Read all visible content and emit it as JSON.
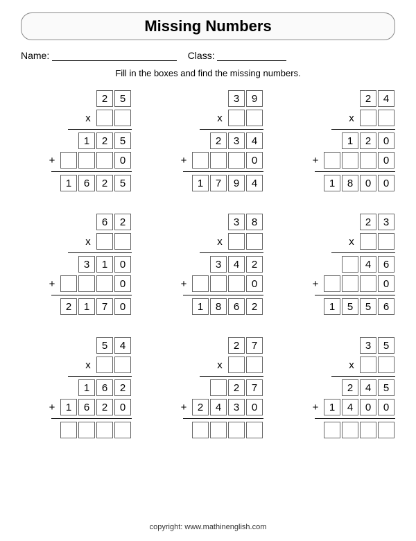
{
  "title": "Missing Numbers",
  "name_label": "Name:",
  "class_label": "Class:",
  "instruction": "Fill in the boxes and find the missing numbers.",
  "copyright": "copyright:   www.mathinenglish.com",
  "problems": [
    {
      "top": [
        "2",
        "5"
      ],
      "mult": [
        "",
        ""
      ],
      "p1": [
        "1",
        "2",
        "5"
      ],
      "p2": [
        "",
        "",
        "",
        "0"
      ],
      "p2box": [
        1,
        1,
        1,
        0
      ],
      "ans": [
        "1",
        "6",
        "2",
        "5"
      ],
      "ansbox": [
        0,
        0,
        0,
        0
      ]
    },
    {
      "top": [
        "3",
        "9"
      ],
      "mult": [
        "",
        ""
      ],
      "p1": [
        "2",
        "3",
        "4"
      ],
      "p2": [
        "",
        "",
        "",
        "0"
      ],
      "p2box": [
        1,
        1,
        1,
        0
      ],
      "ans": [
        "1",
        "7",
        "9",
        "4"
      ],
      "ansbox": [
        0,
        0,
        0,
        0
      ]
    },
    {
      "top": [
        "2",
        "4"
      ],
      "mult": [
        "",
        ""
      ],
      "p1": [
        "1",
        "2",
        "0"
      ],
      "p2": [
        "",
        "",
        "",
        "0"
      ],
      "p2box": [
        1,
        1,
        1,
        0
      ],
      "ans": [
        "1",
        "8",
        "0",
        "0"
      ],
      "ansbox": [
        0,
        0,
        0,
        0
      ]
    },
    {
      "top": [
        "6",
        "2"
      ],
      "mult": [
        "",
        ""
      ],
      "p1": [
        "3",
        "1",
        "0"
      ],
      "p2": [
        "",
        "",
        "",
        "0"
      ],
      "p2box": [
        1,
        1,
        1,
        0
      ],
      "ans": [
        "2",
        "1",
        "7",
        "0"
      ],
      "ansbox": [
        0,
        0,
        0,
        0
      ]
    },
    {
      "top": [
        "3",
        "8"
      ],
      "mult": [
        "",
        ""
      ],
      "p1": [
        "3",
        "4",
        "2"
      ],
      "p2": [
        "",
        "",
        "",
        "0"
      ],
      "p2box": [
        1,
        1,
        1,
        0
      ],
      "ans": [
        "1",
        "8",
        "6",
        "2"
      ],
      "ansbox": [
        0,
        0,
        0,
        0
      ]
    },
    {
      "top": [
        "2",
        "3"
      ],
      "mult": [
        "",
        ""
      ],
      "p13": [
        "",
        "4",
        "6"
      ],
      "p1box": [
        0,
        0,
        0
      ],
      "p2": [
        "",
        "",
        "",
        "0"
      ],
      "p2box": [
        1,
        1,
        1,
        0
      ],
      "ans": [
        "1",
        "5",
        "5",
        "6"
      ],
      "ansbox": [
        0,
        0,
        0,
        0
      ],
      "short": true
    },
    {
      "top": [
        "5",
        "4"
      ],
      "mult": [
        "",
        ""
      ],
      "p1": [
        "1",
        "6",
        "2"
      ],
      "p2": [
        "1",
        "6",
        "2",
        "0"
      ],
      "p2box": [
        0,
        0,
        0,
        0
      ],
      "ans": [
        "",
        "",
        "",
        ""
      ],
      "ansbox": [
        1,
        1,
        1,
        1
      ]
    },
    {
      "top": [
        "2",
        "7"
      ],
      "mult": [
        "",
        ""
      ],
      "p13": [
        "",
        "2",
        "7"
      ],
      "p1box": [
        0,
        0,
        0
      ],
      "p2": [
        "2",
        "4",
        "3",
        "0"
      ],
      "p2box": [
        0,
        0,
        0,
        0
      ],
      "ans": [
        "",
        "",
        "",
        ""
      ],
      "ansbox": [
        1,
        1,
        1,
        1
      ],
      "short": true
    },
    {
      "top": [
        "3",
        "5"
      ],
      "mult": [
        "",
        ""
      ],
      "p1": [
        "2",
        "4",
        "5"
      ],
      "p2": [
        "1",
        "4",
        "0",
        "0"
      ],
      "p2box": [
        0,
        0,
        0,
        0
      ],
      "ans": [
        "",
        "",
        "",
        ""
      ],
      "ansbox": [
        1,
        1,
        1,
        1
      ]
    }
  ]
}
